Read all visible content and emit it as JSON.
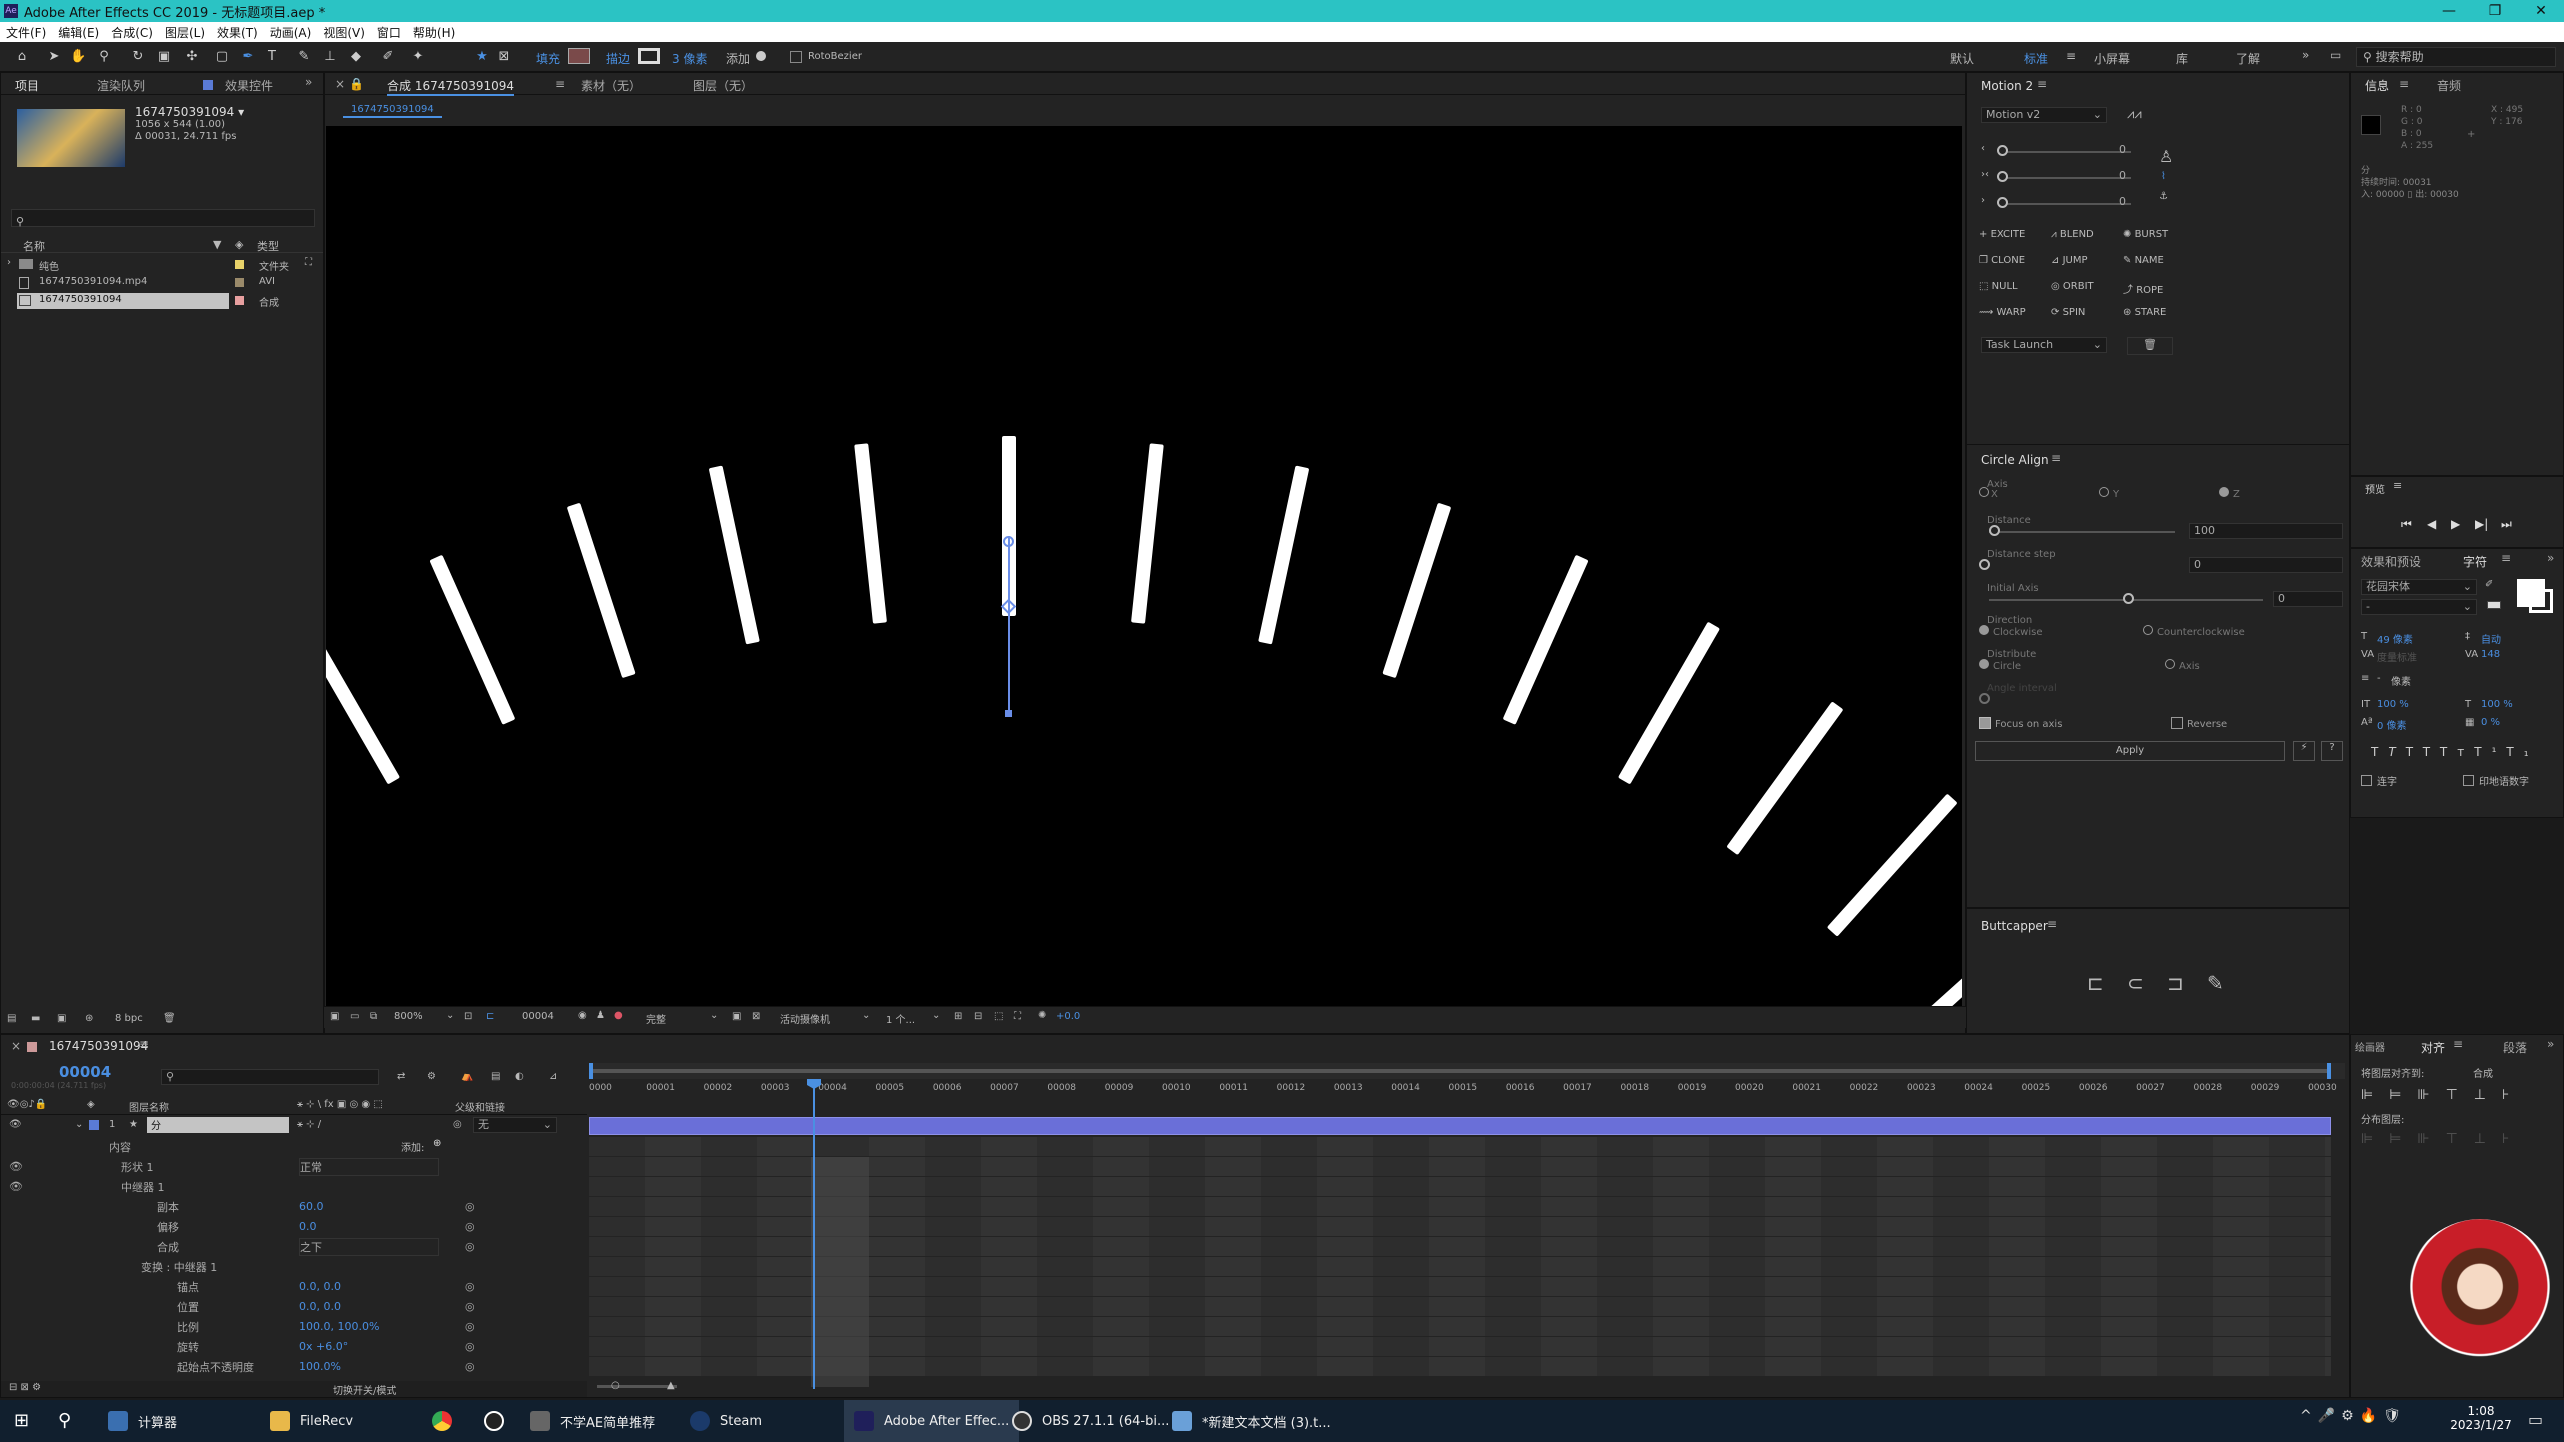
{
  "title": "Adobe After Effects CC 2019 - 无标题项目.aep *",
  "menu": [
    "文件(F)",
    "编辑(E)",
    "合成(C)",
    "图层(L)",
    "效果(T)",
    "动画(A)",
    "视图(V)",
    "窗口",
    "帮助(H)"
  ],
  "toolbar": {
    "fill": "填充",
    "stroke": "描边",
    "stroke_px": "3 像素",
    "add": "添加",
    "roto": "RotoBezier",
    "ws_default": "默认",
    "ws_standard": "标准",
    "ws_small": "小屏幕",
    "ws_lib": "库",
    "ws_learn": "了解",
    "search": "搜索帮助"
  },
  "project": {
    "tabs": [
      "项目",
      "渲染队列",
      "效果控件"
    ],
    "comp_name": "1674750391094 ▾",
    "comp_size": "1056 x 544 (1.00)",
    "comp_dur": "Δ 00031, 24.711 fps",
    "col_name": "名称",
    "col_type": "类型",
    "items": [
      {
        "name": "纯色",
        "type": "文件夹"
      },
      {
        "name": "1674750391094.mp4",
        "type": "AVI"
      },
      {
        "name": "1674750391094",
        "type": "合成"
      }
    ],
    "bpc": "8 bpc"
  },
  "viewer": {
    "tabs": [
      "合成 1674750391094",
      "素材（无）",
      "图层（无）"
    ],
    "subtab": "1674750391094",
    "zoom": "800%",
    "frame": "00004",
    "quality": "完整",
    "camera": "活动摄像机",
    "views": "1 个...",
    "exposure": "+0.0"
  },
  "motion": {
    "title": "Motion 2",
    "preset": "Motion v2",
    "sliders": [
      "0",
      "0",
      "0"
    ],
    "buttons": [
      "EXCITE",
      "BLEND",
      "BURST",
      "CLONE",
      "JUMP",
      "NAME",
      "NULL",
      "ORBIT",
      "ROPE",
      "WARP",
      "SPIN",
      "STARE"
    ],
    "task": "Task Launch"
  },
  "circle": {
    "title": "Circle Align",
    "axis": "Axis",
    "x": "X",
    "y": "Y",
    "z": "Z",
    "distance": "Distance",
    "distance_val": "100",
    "distance_step": "Distance step",
    "distance_step_val": "0",
    "initial_axis": "Initial Axis",
    "initial_val": "0",
    "direction": "Direction",
    "cw": "Clockwise",
    "ccw": "Counterclockwise",
    "distribute": "Distribute",
    "circle": "Circle",
    "axis2": "Axis",
    "angle": "Angle interval",
    "focus": "Focus on axis",
    "reverse": "Reverse",
    "apply": "Apply"
  },
  "butt": {
    "title": "Buttcapper"
  },
  "info": {
    "tabs": [
      "信息",
      "音频"
    ],
    "r": "R : 0",
    "g": "G : 0",
    "b": "B : 0",
    "a": "A : 255",
    "x": "X : 495",
    "y": "Y : 176",
    "label": "分",
    "dur": "持续时间: 00031",
    "inout": "入: 00000 ▯ 出: 00030"
  },
  "preview": {
    "title": "预览"
  },
  "effects": {
    "tabs": [
      "效果和预设",
      "字符"
    ],
    "font": "花园宋体",
    "size": "49 像素",
    "lead": "自动",
    "track": "148",
    "units": "像素",
    "scale_v": "100 %",
    "scale_h": "100 %",
    "baseline": "0 像素",
    "tsume": "0 %",
    "chk1": "连字",
    "chk2": "印地语数字"
  },
  "align": {
    "tabs": [
      "绘画器",
      "对齐",
      "段落"
    ],
    "to": "将图层对齐到:",
    "target": "合成",
    "dist": "分布图层:"
  },
  "timeline": {
    "tab": "1674750391094",
    "time": "00004",
    "time_sub": "0:00:00:04 (24.711 fps)",
    "col_layer": "图层名称",
    "col_parent": "父级和链接",
    "layer_num": "1",
    "layer_name": "分",
    "parent": "无",
    "toggle": "切换开关/模式",
    "add": "添加:",
    "ruler": [
      "0000",
      "00001",
      "00002",
      "00003",
      "00004",
      "00005",
      "00006",
      "00007",
      "00008",
      "00009",
      "00010",
      "00011",
      "00012",
      "00013",
      "00014",
      "00015",
      "00016",
      "00017",
      "00018",
      "00019",
      "00020",
      "00021",
      "00022",
      "00023",
      "00024",
      "00025",
      "00026",
      "00027",
      "00028",
      "00029",
      "00030"
    ],
    "props": [
      {
        "n": "内容",
        "v": ""
      },
      {
        "n": "形状 1",
        "v": "正常"
      },
      {
        "n": "中继器 1",
        "v": ""
      },
      {
        "n": "副本",
        "v": "60.0"
      },
      {
        "n": "偏移",
        "v": "0.0"
      },
      {
        "n": "合成",
        "v": "之下"
      },
      {
        "n": "变换 : 中继器 1",
        "v": ""
      },
      {
        "n": "锚点",
        "v": "0.0, 0.0"
      },
      {
        "n": "位置",
        "v": "0.0, 0.0"
      },
      {
        "n": "比例",
        "v": "100.0, 100.0%"
      },
      {
        "n": "旋转",
        "v": "0x +6.0°"
      },
      {
        "n": "起始点不透明度",
        "v": "100.0%"
      }
    ]
  },
  "taskbar": {
    "items": [
      "计算器",
      "FileRecv",
      "",
      "",
      "不学AE简单推荐",
      "Steam",
      "Adobe After Effec...",
      "OBS 27.1.1 (64-bi...",
      "*新建文本文档 (3).t..."
    ],
    "time": "1:08",
    "date": "2023/1/27"
  }
}
